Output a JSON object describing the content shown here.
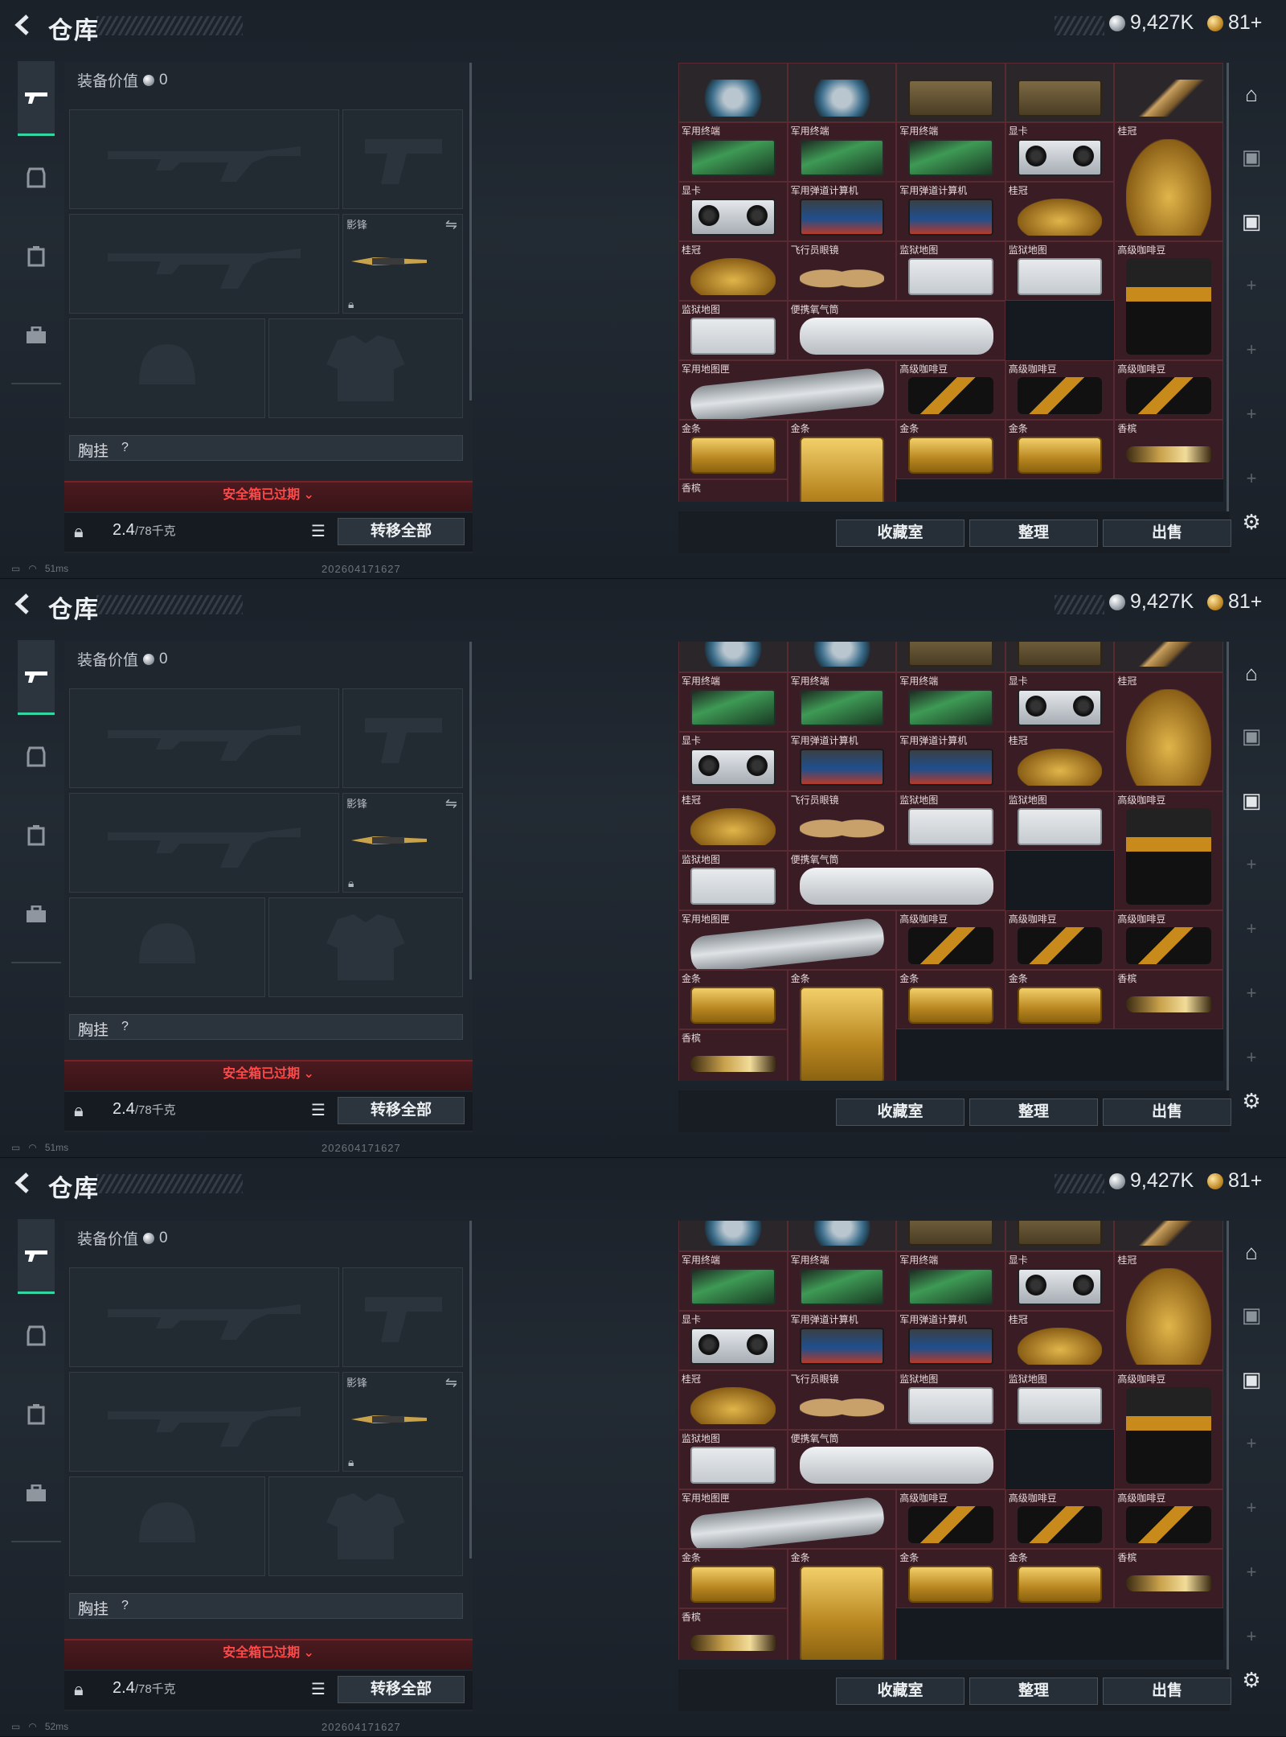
{
  "panels": [
    {
      "header": {
        "title": "仓库",
        "silver": "9,427K",
        "gold": "81+"
      },
      "equipment": {
        "value_label": "装备价值",
        "value": "0",
        "melee_label": "影锋",
        "chest_label": "胸挂",
        "chest_help": "?",
        "secure_expired": "安全箱已过期",
        "weight": "2.4",
        "weight_max": "/78千克",
        "transfer_label": "转移全部"
      },
      "storage": {
        "buttons": [
          "收藏室",
          "整理",
          "出售"
        ],
        "top_row_visible": true
      },
      "status": {
        "ping": "51ms",
        "stamp": "202604171627"
      }
    },
    {
      "header": {
        "title": "仓库",
        "silver": "9,427K",
        "gold": "81+"
      },
      "equipment": {
        "value_label": "装备价值",
        "value": "0",
        "melee_label": "影锋",
        "chest_label": "胸挂",
        "chest_help": "?",
        "secure_expired": "安全箱已过期",
        "weight": "2.4",
        "weight_max": "/78千克",
        "transfer_label": "转移全部"
      },
      "storage": {
        "buttons": [
          "收藏室",
          "整理",
          "出售"
        ],
        "top_row_visible": false
      },
      "status": {
        "ping": "51ms",
        "stamp": "202604171627"
      }
    },
    {
      "header": {
        "title": "仓库",
        "silver": "9,427K",
        "gold": "81+"
      },
      "equipment": {
        "value_label": "装备价值",
        "value": "0",
        "melee_label": "影锋",
        "chest_label": "胸挂",
        "chest_help": "?",
        "secure_expired": "安全箱已过期",
        "weight": "2.4",
        "weight_max": "/78千克",
        "transfer_label": "转移全部"
      },
      "storage": {
        "buttons": [
          "收藏室",
          "整理",
          "出售"
        ],
        "top_row_visible": false
      },
      "status": {
        "ping": "52ms",
        "stamp": "202604171627"
      }
    }
  ],
  "items": {
    "terminal": "军用终端",
    "gpu": "显卡",
    "crown": "桂冠",
    "calculator": "军用弹道计算机",
    "glasses": "飞行员眼镜",
    "prison_map": "监狱地图",
    "coffee": "高级咖啡豆",
    "oxygen": "便携氧气筒",
    "map_tube": "军用地图匣",
    "gold_bar": "金条",
    "champagne": "香槟"
  },
  "colors": {
    "accent": "#33d6a2",
    "alert": "#ff4a4a",
    "cell_bg": "#3a1d24"
  }
}
